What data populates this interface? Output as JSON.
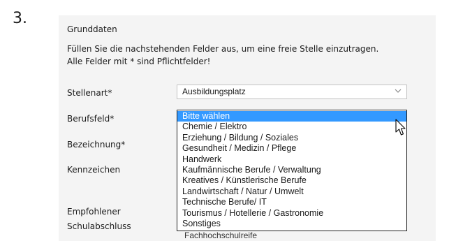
{
  "step_number": "3.",
  "form": {
    "section_title": "Grunddaten",
    "intro_line1": "Füllen Sie die nachstehenden Felder aus, um eine freie Stelle einzutragen.",
    "intro_line2": "Alle Felder mit * sind Pflichtfelder!",
    "labels": {
      "stellenart": "Stellenart*",
      "berufsfeld": "Berufsfeld*",
      "bezeichnung": "Bezeichnung*",
      "kennzeichen": "Kennzeichen",
      "empfohlener_line1": "Empfohlener",
      "empfohlener_line2": "Schulabschluss"
    },
    "stellenart_select": {
      "value": "Ausbildungsplatz",
      "icon": "chevron-down-icon"
    },
    "behind_text": "Fachhochschulreife",
    "berufsfeld_dropdown": {
      "selected_index": 0,
      "options": [
        "Bitte wählen",
        "Chemie / Elektro",
        "Erziehung / Bildung / Soziales",
        "Gesundheit / Medizin / Pflege",
        "Handwerk",
        "Kaufmännische Berufe / Verwaltung",
        "Kreatives / Künstlerische Berufe",
        "Landwirtschaft / Natur / Umwelt",
        "Technische Berufe/ IT",
        "Tourismus / Hotellerie / Gastronomie",
        "Sonstiges"
      ]
    },
    "colors": {
      "highlight": "#3399ff",
      "panel": "#f4f4f4"
    }
  }
}
